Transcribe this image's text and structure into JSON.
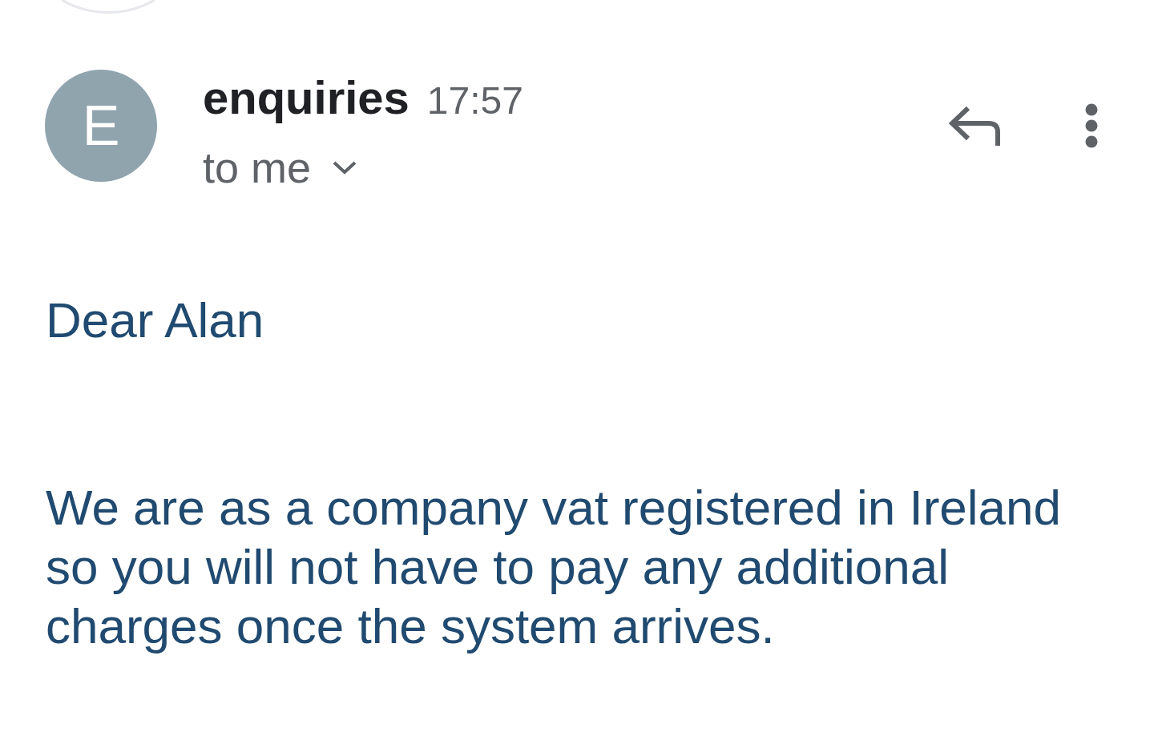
{
  "message_header": {
    "avatar_letter": "E",
    "sender": "enquiries",
    "time": "17:57",
    "recipient": "to me"
  },
  "body": {
    "greeting": "Dear Alan",
    "paragraph": "We are as a company vat registered in Ireland so you will not have to pay any additional charges once the system arrives."
  }
}
